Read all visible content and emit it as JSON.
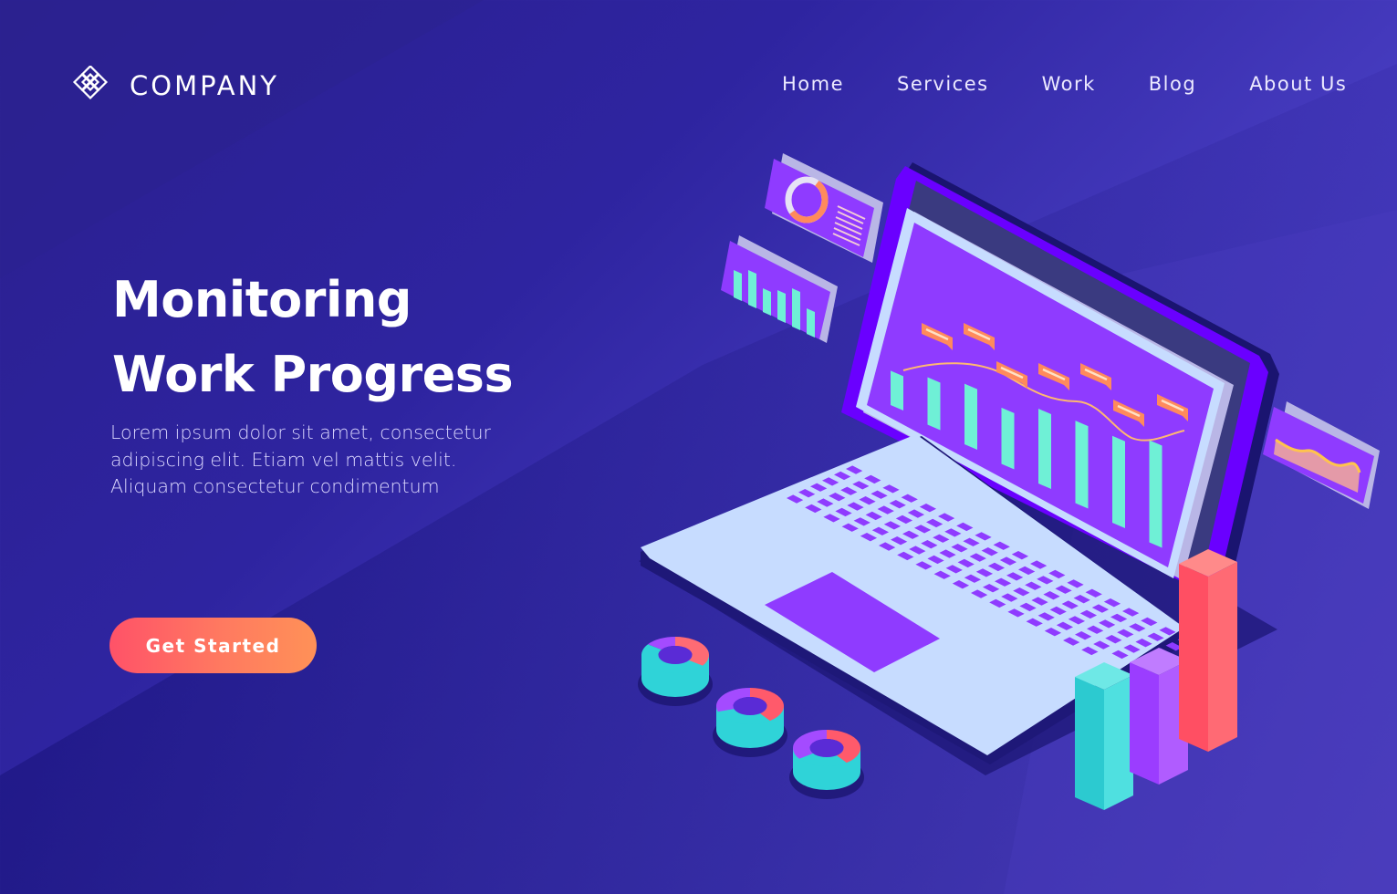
{
  "brand": {
    "name": "COMPANY",
    "logo_icon": "interlocking-diamonds-icon"
  },
  "nav": {
    "items": [
      {
        "label": "Home"
      },
      {
        "label": "Services"
      },
      {
        "label": "Work"
      },
      {
        "label": "Blog"
      },
      {
        "label": "About Us"
      }
    ]
  },
  "hero": {
    "title_lines": [
      "Monitoring",
      "Work Progress"
    ],
    "body_lines": [
      "Lorem ipsum dolor sit amet, consectetur",
      "adipiscing elit. Etiam vel mattis velit.",
      "Aliquam consectetur condimentum"
    ],
    "cta_label": "Get Started"
  },
  "illustration": {
    "subject": "isometric-laptop-with-dashboard-charts",
    "screen_bar_levels": [
      0.18,
      0.3,
      0.42,
      0.38,
      0.55,
      0.62,
      0.66,
      0.8
    ],
    "side_card_bar_levels": [
      0.55,
      0.75,
      0.45,
      0.6,
      0.85,
      0.5
    ],
    "donut_card_fraction": 0.55,
    "floor_bar_levels": [
      0.55,
      0.5,
      0.8
    ]
  },
  "colors": {
    "background_dark": "#1c1480",
    "background_light": "#6b58e0",
    "accent_purple": "#8f3bff",
    "accent_teal": "#6ff0d6",
    "accent_orange": "#ff8a5c",
    "accent_red": "#ff5a6b",
    "laptop_body": "#c7dcff",
    "cta_gradient_start": "#ff5268",
    "cta_gradient_end": "#ff9157"
  }
}
